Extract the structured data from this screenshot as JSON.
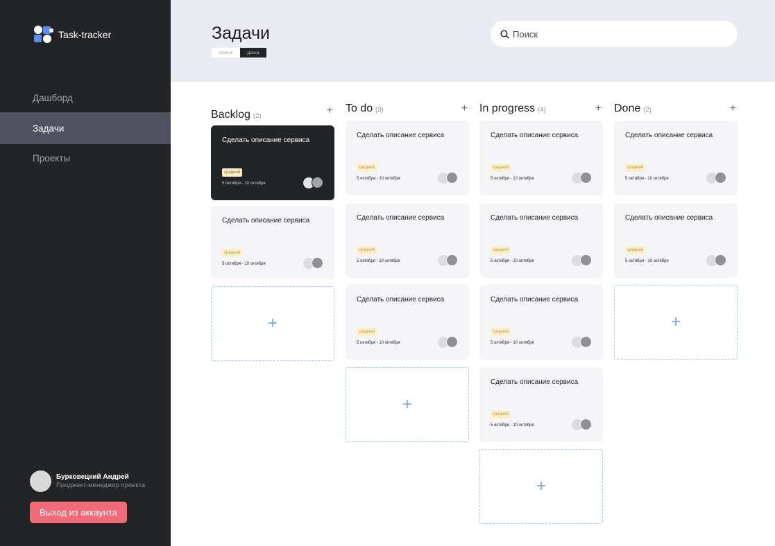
{
  "brand": {
    "name": "Task-tracker",
    "logo_icon": "app-logo-icon"
  },
  "nav": {
    "items": [
      {
        "label": "Дашборд",
        "active": false
      },
      {
        "label": "Задачи",
        "active": true
      },
      {
        "label": "Проекты",
        "active": false
      }
    ]
  },
  "user": {
    "name": "Бурковецкий Андрей",
    "role": "Проджект-менеджер проекта"
  },
  "logout_label": "Выход из аккаунта",
  "header": {
    "title": "Задачи",
    "view_list": "список",
    "view_board": "доска"
  },
  "search": {
    "placeholder": "Поиск",
    "value": ""
  },
  "colors": {
    "sidebar": "#232425",
    "active_nav": "#4e525e",
    "logout": "#ef6b77",
    "header_bg": "#ebecf3",
    "add_border": "#a9c8ea"
  },
  "columns": [
    {
      "title": "Backlog",
      "count": "(2)",
      "add": "+",
      "cards": [
        {
          "title": "Сделать описание сервиса",
          "priority": "средний",
          "dates": "5 октября - 10 октября",
          "dark": true
        },
        {
          "title": "Сделать описание сервиса",
          "priority": "средний",
          "dates": "5 октября - 10 октября",
          "dark": false
        }
      ]
    },
    {
      "title": "To do",
      "count": "(3)",
      "add": "+",
      "cards": [
        {
          "title": "Сделать описание сервиса",
          "priority": "средний",
          "dates": "5 октября - 10 октября",
          "dark": false
        },
        {
          "title": "Сделать описание сервиса",
          "priority": "средний",
          "dates": "5 октября - 10 октября",
          "dark": false
        },
        {
          "title": "Сделать описание сервиса",
          "priority": "средний",
          "dates": "5 октября - 10 октября",
          "dark": false
        }
      ]
    },
    {
      "title": "In progress",
      "count": "(4)",
      "add": "+",
      "cards": [
        {
          "title": "Сделать описание сервиса",
          "priority": "средний",
          "dates": "5 октября - 10 октября",
          "dark": false
        },
        {
          "title": "Сделать описание сервиса",
          "priority": "средний",
          "dates": "5 октября - 10 октября",
          "dark": false
        },
        {
          "title": "Сделать описание сервиса",
          "priority": "средний",
          "dates": "5 октября - 10 октября",
          "dark": false
        },
        {
          "title": "Сделать описание сервиса",
          "priority": "средний",
          "dates": "5 октября - 10 октября",
          "dark": false
        }
      ]
    },
    {
      "title": "Done",
      "count": "(2)",
      "add": "+",
      "cards": [
        {
          "title": "Сделать описание сервиса",
          "priority": "средний",
          "dates": "5 октября - 10 октября",
          "dark": false
        },
        {
          "title": "Сделать описание сервиса",
          "priority": "средний",
          "dates": "5 октября - 10 октября",
          "dark": false
        }
      ]
    }
  ],
  "add_card_symbol": "+"
}
